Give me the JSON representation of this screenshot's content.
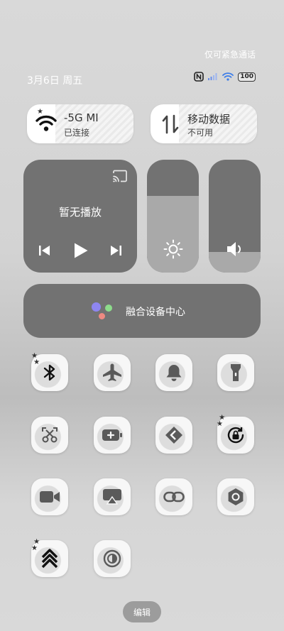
{
  "status": {
    "emergency_note": "仅可紧急通话",
    "date": "3月6日 周五",
    "battery": "100"
  },
  "wifi_pill": {
    "title": "-5G MI",
    "subtitle": "已连接"
  },
  "data_pill": {
    "title": "移动数据",
    "subtitle": "不可用"
  },
  "media": {
    "title": "暂无播放"
  },
  "brightness": {
    "level": 0.68
  },
  "volume": {
    "level": 0.18
  },
  "device_center": {
    "label": "融合设备中心"
  },
  "toggles": [
    {
      "icon": "bluetooth-icon"
    },
    {
      "icon": "airplane-icon"
    },
    {
      "icon": "bell-icon"
    },
    {
      "icon": "flashlight-icon"
    },
    {
      "icon": "screenshot-scissors-icon"
    },
    {
      "icon": "battery-saver-icon"
    },
    {
      "icon": "nearby-share-icon"
    },
    {
      "icon": "rotation-lock-icon"
    },
    {
      "icon": "video-camera-icon"
    },
    {
      "icon": "screen-cast-icon"
    },
    {
      "icon": "link-icon"
    },
    {
      "icon": "camera-settings-icon"
    },
    {
      "icon": "chevrons-up-icon"
    },
    {
      "icon": "dark-mode-icon"
    }
  ],
  "edit": {
    "label": "编辑"
  },
  "colors": {
    "panel": "#727272",
    "slider_fill": "#a9a9a9",
    "tile": "#f7f7f7",
    "dot_purple": "#8e86f0",
    "dot_green": "#8ddc8b",
    "dot_pink": "#ee8a82"
  }
}
